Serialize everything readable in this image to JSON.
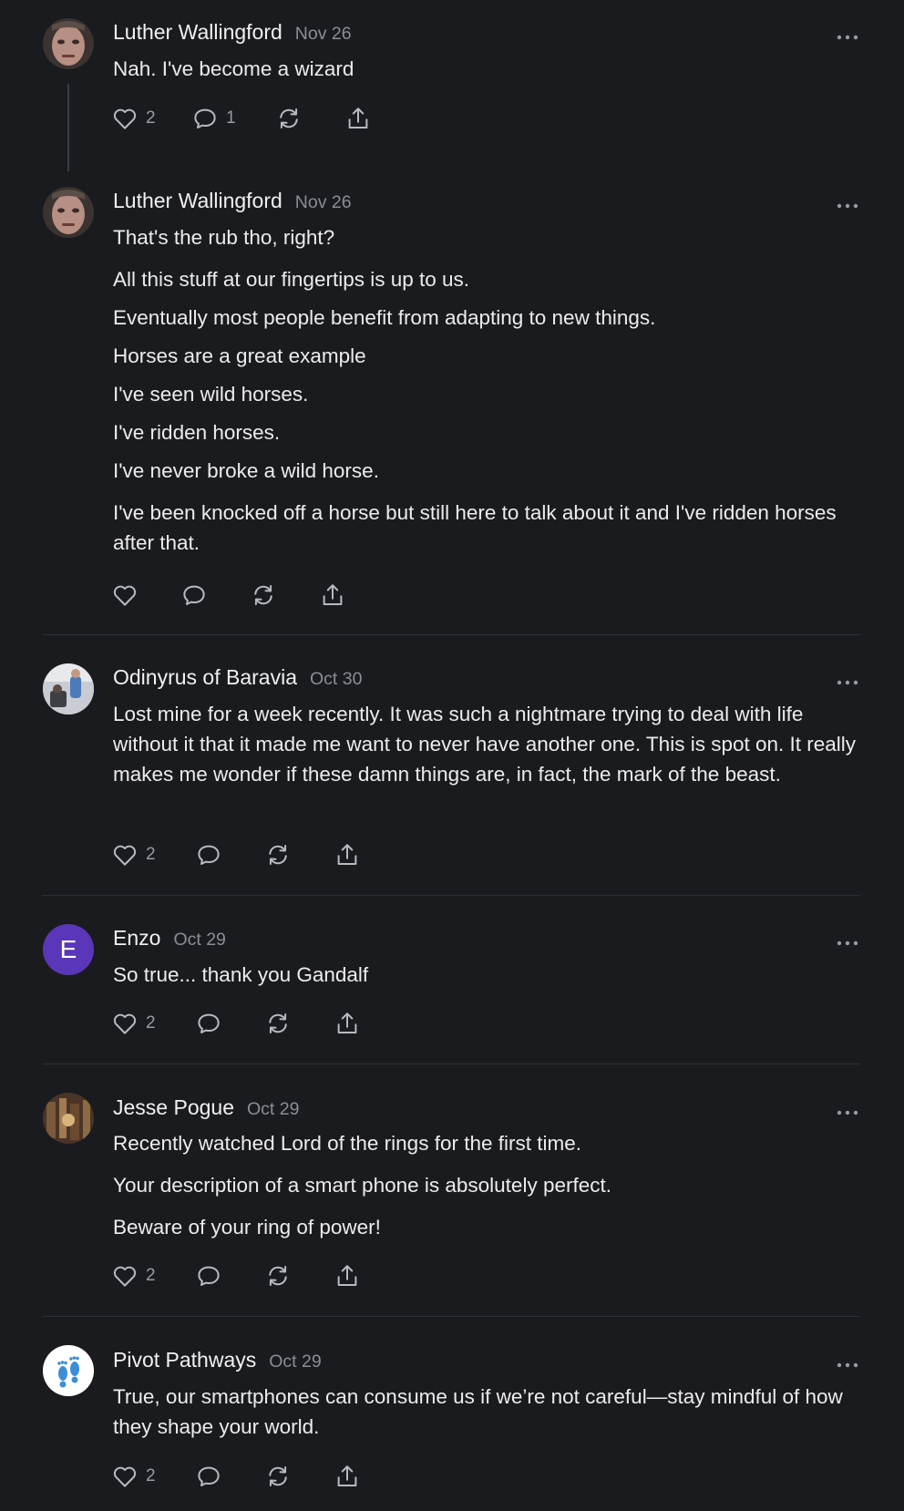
{
  "comments": [
    {
      "author": "Luther Wallingford",
      "date": "Nov 26",
      "paragraphs": [
        "Nah. I've become a wizard"
      ],
      "likes": "2",
      "replies": "1"
    },
    {
      "author": "Luther Wallingford",
      "date": "Nov 26",
      "paragraphs": [
        "That's the rub tho, right?",
        "All this stuff at our fingertips is up to us.",
        "Eventually most people benefit from adapting to new things.",
        "Horses are a great example",
        "I've seen wild horses.",
        "I've ridden horses.",
        "I've never broke a wild horse.",
        "I've been knocked off a horse but still here to talk about it and I've ridden horses after that."
      ]
    },
    {
      "author": "Odinyrus of Baravia",
      "date": "Oct 30",
      "paragraphs": [
        "Lost mine for a week recently. It was such a nightmare trying to deal with life without it that it made me want to never have another one. This is spot on. It really makes me wonder if these damn things are, in fact, the mark of the beast."
      ],
      "likes": "2"
    },
    {
      "author": "Enzo",
      "avatar_letter": "E",
      "date": "Oct 29",
      "paragraphs": [
        "So true... thank you Gandalf"
      ],
      "likes": "2"
    },
    {
      "author": "Jesse Pogue",
      "date": "Oct 29",
      "paragraphs": [
        "Recently watched Lord of the rings for the first time.",
        "Your description of a smart phone is absolutely perfect.",
        "Beware of your ring of power!"
      ],
      "likes": "2"
    },
    {
      "author": "Pivot Pathways",
      "date": "Oct 29",
      "paragraphs": [
        "True, our smartphones can consume us if we’re not careful—stay mindful of how they shape your world."
      ],
      "likes": "2"
    }
  ],
  "colors": {
    "background": "#1a1b1f",
    "text": "#ececee",
    "muted": "#8c8d93",
    "icon": "#b9babf",
    "enzo_avatar": "#5a37b8"
  },
  "icons": [
    "heart-icon",
    "comment-icon",
    "repost-icon",
    "share-icon",
    "more-icon"
  ]
}
